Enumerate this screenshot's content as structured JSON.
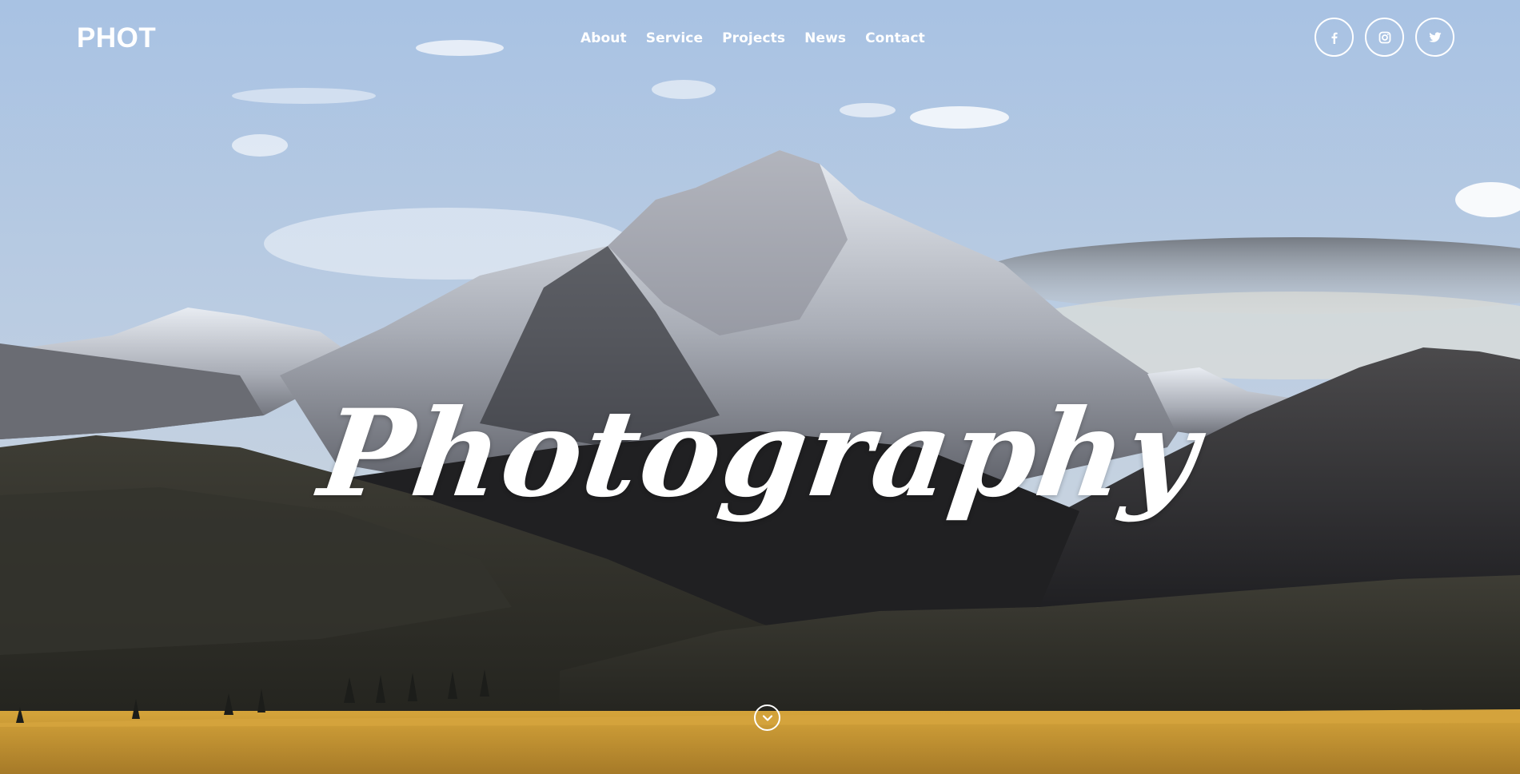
{
  "header": {
    "logo": "PHOT",
    "nav": [
      {
        "label": "About"
      },
      {
        "label": "Service"
      },
      {
        "label": "Projects"
      },
      {
        "label": "News"
      },
      {
        "label": "Contact"
      }
    ],
    "socials": [
      "facebook-icon",
      "instagram-icon",
      "twitter-icon"
    ]
  },
  "hero": {
    "title": "Photography",
    "scroll_icon": "chevron-down-icon",
    "background": "mountain-landscape-photo"
  },
  "colors": {
    "text": "#ffffff",
    "sky": "#a9c3e0",
    "field": "#c89a35"
  }
}
